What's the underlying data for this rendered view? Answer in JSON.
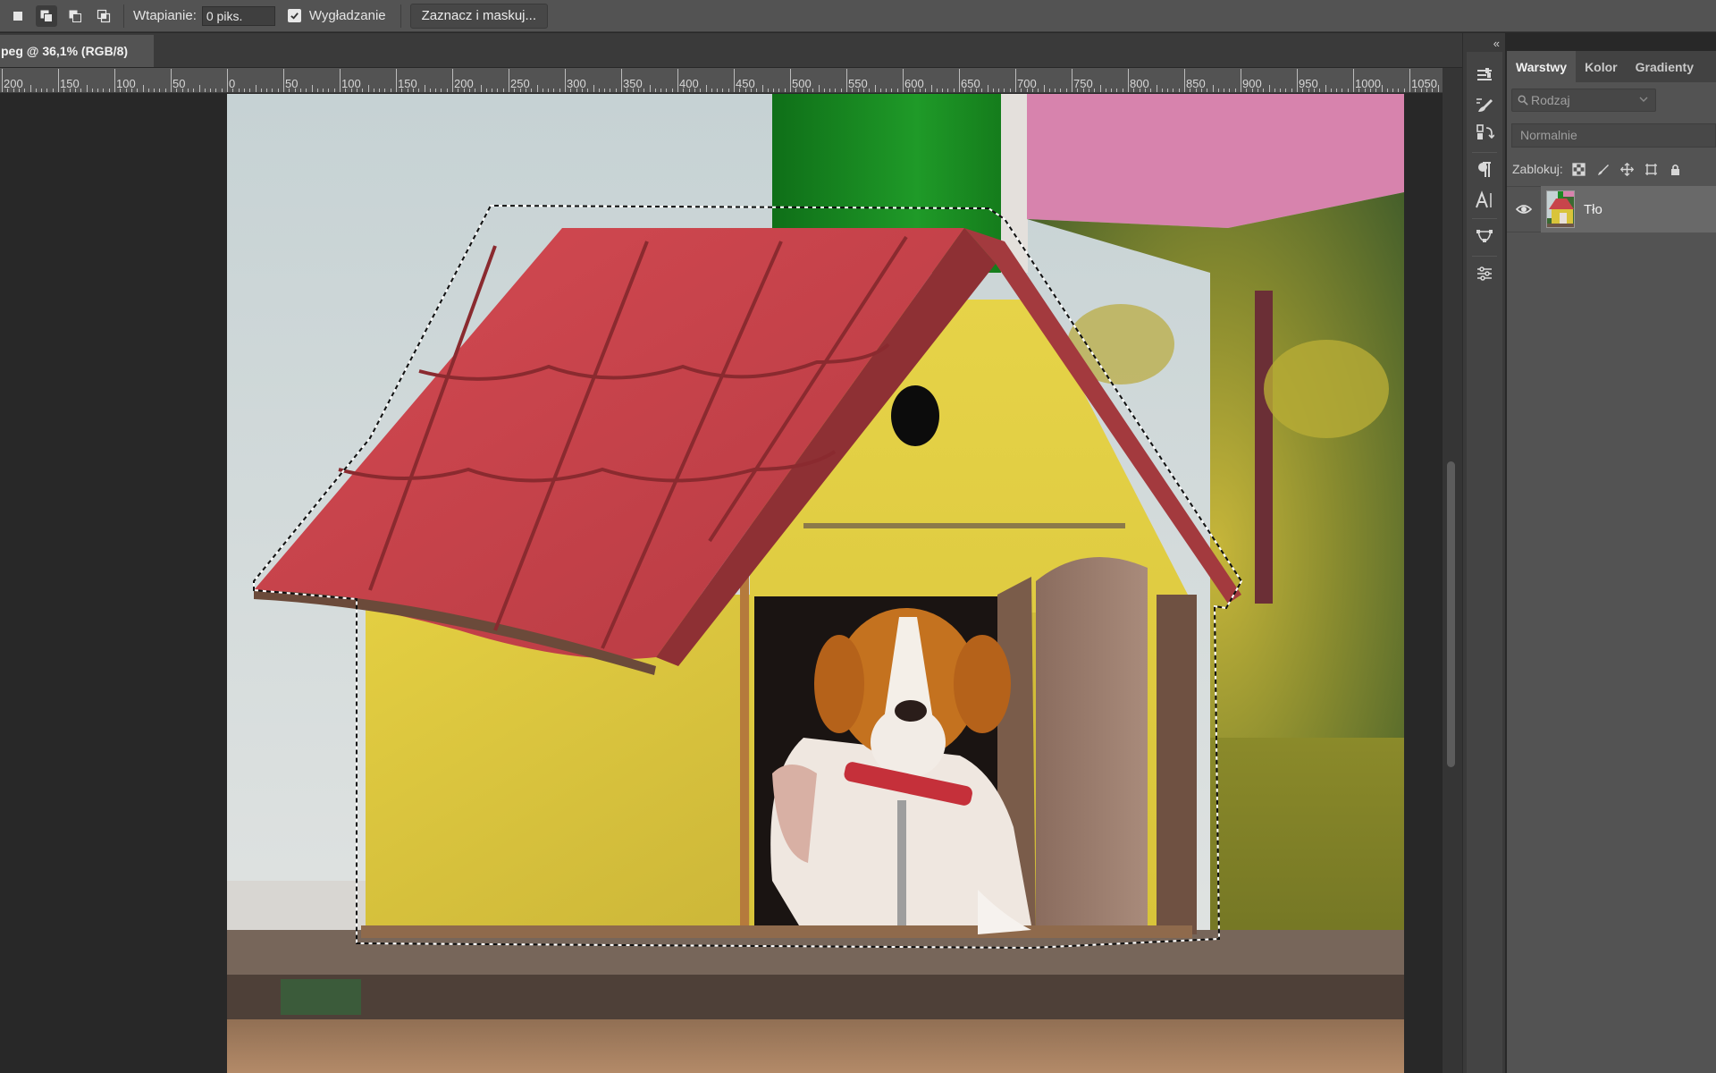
{
  "options_bar": {
    "feather_label": "Wtapianie:",
    "feather_value": "0 piks.",
    "antialias_label": "Wygładzanie",
    "antialias_checked": true,
    "select_mask_button": "Zaznacz i maskuj..."
  },
  "document": {
    "tab_title": "peg @ 36,1% (RGB/8)"
  },
  "ruler": {
    "labels": [
      "200",
      "150",
      "100",
      "50",
      "0",
      "50",
      "100",
      "150",
      "200",
      "250",
      "300",
      "350",
      "400",
      "450",
      "500",
      "550",
      "600",
      "650",
      "700",
      "750",
      "800",
      "850",
      "900",
      "950",
      "1000",
      "1050"
    ]
  },
  "toolstrip": {
    "collapse_glyph": "«",
    "tools": [
      "brush-settings-icon",
      "brushes-icon",
      "clone-source-icon",
      "paragraph-icon",
      "character-icon",
      "paths-icon",
      "adjustments-icon"
    ]
  },
  "layers_panel": {
    "tabs": [
      {
        "label": "Warstwy",
        "active": true
      },
      {
        "label": "Kolor",
        "active": false
      },
      {
        "label": "Gradienty",
        "active": false
      }
    ],
    "filter_placeholder": "Rodzaj",
    "blend_mode": "Normalnie",
    "lock_label": "Zablokuj:",
    "layers": [
      {
        "name": "Tło",
        "visible": true,
        "selected": true
      }
    ]
  },
  "colors": {
    "options_bg": "#535353",
    "workspace_bg": "#282828",
    "panel_bg": "#535353",
    "selected_layer": "#696969",
    "roof_red": "#c8444b",
    "house_yellow": "#d9c43a",
    "pink_wall": "#d783ad",
    "green_wall": "#1d8a24"
  }
}
